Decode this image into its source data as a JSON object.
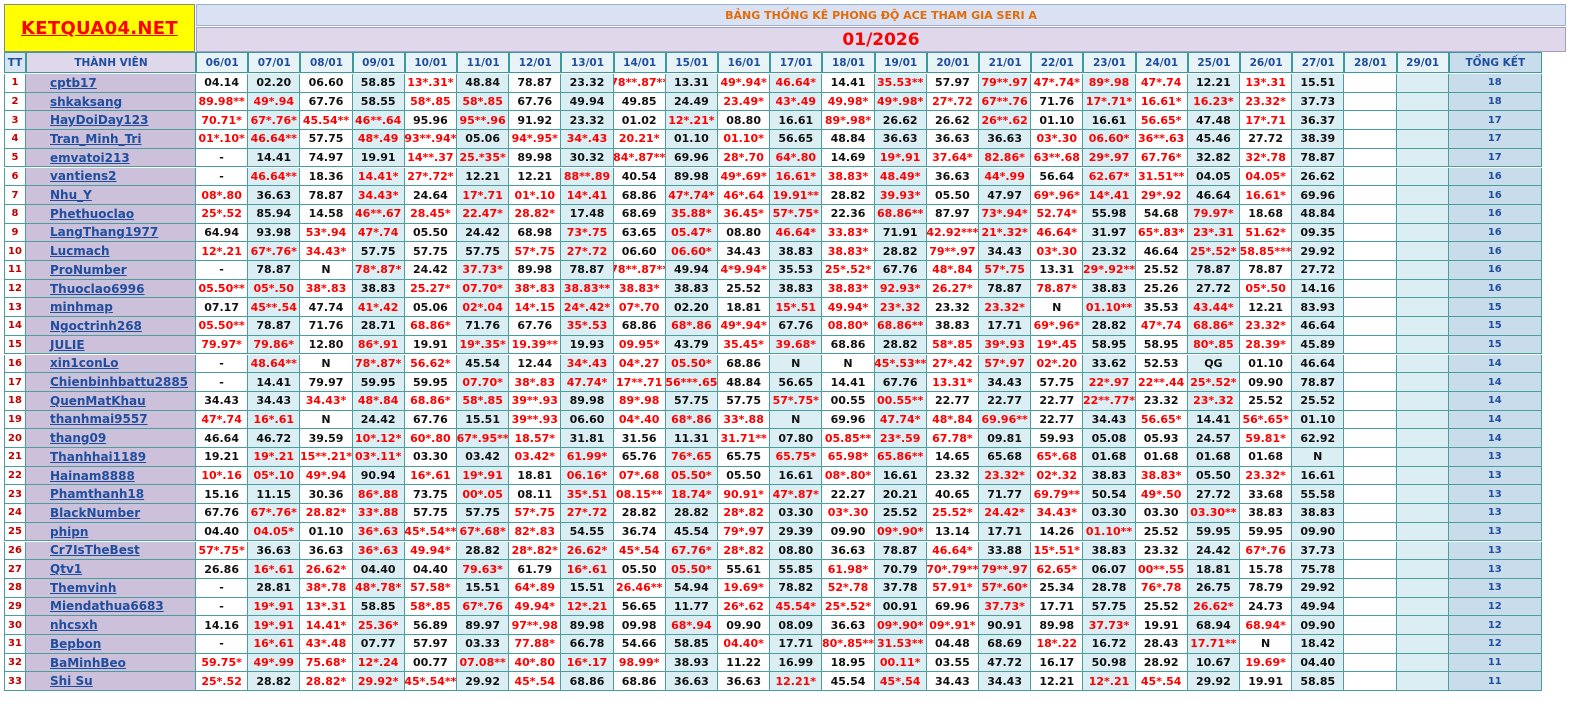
{
  "logo": "KETQUA04.NET",
  "title": "BẢNG THỐNG KÊ PHONG ĐỘ ACE THAM GIA SERI A",
  "month": "01/2026",
  "headers": {
    "tt": "TT",
    "name": "THÀNH VIÊN",
    "total": "TỔNG KẾT"
  },
  "dates": [
    "06/01",
    "07/01",
    "08/01",
    "09/01",
    "10/01",
    "11/01",
    "12/01",
    "13/01",
    "14/01",
    "15/01",
    "16/01",
    "17/01",
    "18/01",
    "19/01",
    "20/01",
    "21/01",
    "22/01",
    "23/01",
    "24/01",
    "25/01",
    "26/01",
    "27/01",
    "28/01",
    "29/01"
  ],
  "rows": [
    {
      "tt": "1",
      "name": "cptb17",
      "total": "18",
      "cells": [
        "04.14",
        "02.20",
        "06.60",
        "58.85",
        "13*.31*",
        "48.84",
        "78.87",
        "23.32",
        "78**.87**",
        "13.31",
        "49*.94*",
        "46.64*",
        "14.41",
        "35.53**",
        "57.97",
        "79**.97",
        "47*.74*",
        "89*.98",
        "47*.74",
        "12.21",
        "13*.31",
        "15.51",
        "",
        ""
      ]
    },
    {
      "tt": "2",
      "name": "shkaksang",
      "total": "18",
      "cells": [
        "89.98**",
        "49*.94",
        "67.76",
        "58.55",
        "58*.85",
        "58*.85",
        "67.76",
        "49.94",
        "49.85",
        "24.49",
        "23.49*",
        "43*.49",
        "49.98*",
        "49*.98*",
        "27*.72",
        "67**.76",
        "71.76",
        "17*.71*",
        "16.61*",
        "16.23*",
        "23.32*",
        "37.73",
        "",
        ""
      ]
    },
    {
      "tt": "3",
      "name": "HayDoiDay123",
      "total": "17",
      "cells": [
        "70.71*",
        "67*.76*",
        "45.54**",
        "46**.64",
        "95.96",
        "95**.96",
        "91.92",
        "23.32",
        "01.02",
        "12*.21*",
        "08.80",
        "16.61",
        "89*.98*",
        "26.62",
        "26.62",
        "26**.62",
        "01.10",
        "16.61",
        "56.65*",
        "47.48",
        "17*.71",
        "36.37",
        "",
        ""
      ]
    },
    {
      "tt": "4",
      "name": "Tran_Minh_Tri",
      "total": "17",
      "cells": [
        "01*.10*",
        "46.64**",
        "57.75",
        "48*.49",
        "93**.94*",
        "05.06",
        "94*.95*",
        "34*.43",
        "20.21*",
        "01.10",
        "01.10*",
        "56.65",
        "48.84",
        "36.63",
        "36.63",
        "36.63",
        "03*.30",
        "06.60*",
        "36**.63",
        "45.46",
        "27.72",
        "38.39",
        "",
        ""
      ]
    },
    {
      "tt": "5",
      "name": "emvatoi213",
      "total": "17",
      "cells": [
        "-",
        "14.41",
        "74.97",
        "19.91",
        "14**.37",
        "25.*35*",
        "89.98",
        "30.32",
        "84*.87**",
        "69.96",
        "28*.70",
        "64*.80",
        "14.69",
        "19*.91",
        "37.64*",
        "82.86*",
        "63**.68",
        "29*.97",
        "67.76*",
        "32.82",
        "32*.78",
        "78.87",
        "",
        ""
      ]
    },
    {
      "tt": "6",
      "name": "vantiens2",
      "total": "16",
      "cells": [
        "-",
        "46.64**",
        "18.36",
        "14.41*",
        "27*.72*",
        "12.21",
        "12.21",
        "88**.89",
        "40.54",
        "89.98",
        "49*.69*",
        "16.61*",
        "38.83*",
        "48.49*",
        "36.63",
        "44*.99",
        "56.64",
        "62.67*",
        "31.51**",
        "04.05",
        "04.05*",
        "26.62",
        "",
        ""
      ]
    },
    {
      "tt": "7",
      "name": "Nhu_Y",
      "total": "16",
      "cells": [
        "08*.80",
        "36.63",
        "78.87",
        "34.43*",
        "24.64",
        "17*.71",
        "01*.10",
        "14*.41",
        "68.86",
        "47*.74*",
        "46*.64",
        "19.91**",
        "28.82",
        "39.93*",
        "05.50",
        "47.97",
        "69*.96*",
        "14*.41",
        "29*.92",
        "46.64",
        "16.61*",
        "69.96",
        "",
        ""
      ]
    },
    {
      "tt": "8",
      "name": "Phethuoclao",
      "total": "16",
      "cells": [
        "25*.52",
        "85.94",
        "14.58",
        "46**.67",
        "28.45*",
        "22.47*",
        "28.82*",
        "17.48",
        "68.69",
        "35.88*",
        "36.45*",
        "57*.75*",
        "22.36",
        "68.86**",
        "87.97",
        "73*.94*",
        "52.74*",
        "55.98",
        "54.68",
        "79.97*",
        "18.68",
        "48.84",
        "",
        ""
      ]
    },
    {
      "tt": "9",
      "name": "LangThang1977",
      "total": "16",
      "cells": [
        "64.94",
        "93.98",
        "53*.94",
        "47*.74",
        "05.50",
        "24.42",
        "68.98",
        "73*.75",
        "63.65",
        "05.47*",
        "08.80",
        "46.64*",
        "33.83*",
        "71.91",
        "42.92***",
        "21*.32*",
        "46.64*",
        "31.97",
        "65*.83*",
        "23*.31",
        "51.62*",
        "09.35",
        "",
        ""
      ]
    },
    {
      "tt": "10",
      "name": "Lucmach",
      "total": "16",
      "cells": [
        "12*.21",
        "67*.76*",
        "34.43*",
        "57.75",
        "57.75",
        "57.75",
        "57*.75",
        "27*.72",
        "06.60",
        "06.60*",
        "34.43",
        "38.83",
        "38.83*",
        "28.82",
        "79**.97",
        "34.43",
        "03*.30",
        "23.32",
        "46.64",
        "25*.52*",
        "58.85***",
        "29.92",
        "",
        ""
      ]
    },
    {
      "tt": "11",
      "name": "ProNumber",
      "total": "16",
      "cells": [
        "-",
        "78.87",
        "N",
        "78*.87*",
        "24.42",
        "37.73*",
        "89.98",
        "78.87",
        "78**.87**",
        "49.94",
        "4*9.94*",
        "35.53",
        "25*.52*",
        "67.76",
        "48*.84",
        "57*.75",
        "13.31",
        "29*.92**",
        "25.52",
        "78.87",
        "78.87",
        "27.72",
        "",
        ""
      ]
    },
    {
      "tt": "12",
      "name": "Thuoclao6996",
      "total": "16",
      "cells": [
        "05.50**",
        "05*.50",
        "38*.83",
        "38.83",
        "25.27*",
        "07.70*",
        "38*.83",
        "38.83**",
        "38.83*",
        "38.83",
        "25.52",
        "38.83",
        "38.83*",
        "92.93*",
        "26.27*",
        "78.87",
        "78.87*",
        "38.83",
        "25.26",
        "27.72",
        "05*.50",
        "14.16",
        "",
        ""
      ]
    },
    {
      "tt": "13",
      "name": "minhmap",
      "total": "15",
      "cells": [
        "07.17",
        "45**.54",
        "47.74",
        "41*.42",
        "05.06",
        "02*.04",
        "14*.15",
        "24*.42*",
        "07*.70",
        "02.20",
        "18.81",
        "15*.51",
        "49.94*",
        "23*.32",
        "23.32",
        "23.32*",
        "N",
        "01.10**",
        "35.53",
        "43.44*",
        "12.21",
        "83.93",
        "",
        ""
      ]
    },
    {
      "tt": "14",
      "name": "Ngoctrinh268",
      "total": "15",
      "cells": [
        "05.50**",
        "78.87",
        "71.76",
        "28.71",
        "68.86*",
        "71.76",
        "67.76",
        "35*.53",
        "68.86",
        "68*.86",
        "49*.94*",
        "67.76",
        "08.80*",
        "68.86**",
        "38.83",
        "17.71",
        "69*.96*",
        "28.82",
        "47*.74",
        "68.86*",
        "23.32*",
        "46.64",
        "",
        ""
      ]
    },
    {
      "tt": "15",
      "name": "JULIE",
      "total": "15",
      "cells": [
        "79.97*",
        "79.86*",
        "12.80",
        "86*.91",
        "19.91",
        "19*.35*",
        "19.39**",
        "19.93",
        "09.95*",
        "43.79",
        "35.45*",
        "39.68*",
        "68.86",
        "28.82",
        "58*.85",
        "39*.93",
        "19*.45",
        "58.95",
        "58.95",
        "80*.85",
        "28.39*",
        "45.89",
        "",
        ""
      ]
    },
    {
      "tt": "16",
      "name": "xin1conLo",
      "total": "14",
      "cells": [
        "-",
        "48.64**",
        "N",
        "78*.87*",
        "56.62*",
        "45.54",
        "12.44",
        "34*.43",
        "04*.27",
        "05.50*",
        "68.86",
        "N",
        "N",
        "45*.53**",
        "27*.42",
        "57*.97",
        "02*.20",
        "33.62",
        "52.53",
        "QG",
        "01.10",
        "46.64",
        "",
        ""
      ]
    },
    {
      "tt": "17",
      "name": "Chienbinhbattu2885",
      "total": "14",
      "cells": [
        "-",
        "14.41",
        "79.97",
        "59.95",
        "59.95",
        "07.70*",
        "38*.83",
        "47.74*",
        "17**.71",
        "56***.65",
        "48.84",
        "56.65",
        "14.41",
        "67.76",
        "13.31*",
        "34.43",
        "57.75",
        "22*.97",
        "22**.44",
        "25*.52*",
        "09.90",
        "78.87",
        "",
        ""
      ]
    },
    {
      "tt": "18",
      "name": "QuenMatKhau",
      "total": "14",
      "cells": [
        "34.43",
        "34.43",
        "34.43*",
        "48*.84",
        "68.86*",
        "58*.85",
        "39**.93",
        "89.98",
        "89*.98",
        "57.75",
        "57.75",
        "57*.75*",
        "00.55",
        "00.55**",
        "22.77",
        "22.77",
        "22.77",
        "22**.77*",
        "23.32",
        "23*.32",
        "25.52",
        "25.52",
        "",
        ""
      ]
    },
    {
      "tt": "19",
      "name": "thanhmai9557",
      "total": "14",
      "cells": [
        "47*.74",
        "16*.61",
        "N",
        "24.42",
        "67.76",
        "15.51",
        "39**.93",
        "06.60",
        "04*.40",
        "68*.86",
        "33*.88",
        "N",
        "69.96",
        "47.74*",
        "48*.84",
        "69.96**",
        "22.77",
        "34.43",
        "56.65*",
        "14.41",
        "56*.65*",
        "01.10",
        "",
        ""
      ]
    },
    {
      "tt": "20",
      "name": "thang09",
      "total": "14",
      "cells": [
        "46.64",
        "46.72",
        "39.59",
        "10*.12*",
        "60*.80",
        "67*.95**",
        "18.57*",
        "31.81",
        "31.56",
        "11.31",
        "31.71**",
        "07.80",
        "05.85**",
        "23*.59",
        "67.78*",
        "09.81",
        "59.93",
        "05.08",
        "05.93",
        "24.57",
        "59.81*",
        "62.92",
        "",
        ""
      ]
    },
    {
      "tt": "21",
      "name": "Thanhhai1189",
      "total": "13",
      "cells": [
        "19.21",
        "19*.21",
        "15**.21*",
        "03*.11*",
        "03.30",
        "03.42",
        "03.42*",
        "61.99*",
        "65.76",
        "76*.65",
        "65.75",
        "65.75*",
        "65.98*",
        "65.86**",
        "14.65",
        "65.68",
        "65*.68",
        "01.68",
        "01.68",
        "01.68",
        "01.68",
        "N",
        "",
        ""
      ]
    },
    {
      "tt": "22",
      "name": "Hainam8888",
      "total": "13",
      "cells": [
        "10*.16",
        "05*.10",
        "49*.94",
        "90.94",
        "16*.61",
        "19*.91",
        "18.81",
        "06.16*",
        "07*.68",
        "05.50*",
        "05.50",
        "16.61",
        "08*.80*",
        "16.61",
        "23.32",
        "23.32*",
        "02*.32",
        "38.83",
        "38.83*",
        "05.50",
        "23.32*",
        "16.61",
        "",
        ""
      ]
    },
    {
      "tt": "23",
      "name": "Phamthanh18",
      "total": "13",
      "cells": [
        "15.16",
        "11.15",
        "30.36",
        "86*.88",
        "73.75",
        "00*.05",
        "08.11",
        "35*.51",
        "08.15**",
        "18.74*",
        "90.91*",
        "47*.87*",
        "22.27",
        "20.21",
        "40.65",
        "71.77",
        "69.79**",
        "50.54",
        "49*.50",
        "27.72",
        "33.68",
        "55.58",
        "",
        ""
      ]
    },
    {
      "tt": "24",
      "name": "BlackNumber",
      "total": "13",
      "cells": [
        "67.76",
        "67*.76*",
        "28.82*",
        "33*.88",
        "57.75",
        "57.75",
        "57*.75",
        "27*.72",
        "28.82",
        "28.82",
        "28*.82",
        "03.30",
        "03*.30",
        "25.52",
        "25.52*",
        "24.42*",
        "34.43*",
        "03.30",
        "03.30",
        "03.30**",
        "38.83",
        "38.83",
        "",
        ""
      ]
    },
    {
      "tt": "25",
      "name": "phipn",
      "total": "13",
      "cells": [
        "04.40",
        "04.05*",
        "01.10",
        "36*.63",
        "45*.54**",
        "67*.68*",
        "82*.83",
        "54.55",
        "36.74",
        "45.54",
        "79*.97",
        "29.39",
        "09.90",
        "09*.90*",
        "13.14",
        "17.71",
        "14.26",
        "01.10**",
        "25.52",
        "59.95",
        "59.95",
        "09.90",
        "",
        ""
      ]
    },
    {
      "tt": "26",
      "name": "Cr7IsTheBest",
      "total": "13",
      "cells": [
        "57*.75*",
        "36.63",
        "36.63",
        "36*.63",
        "49.94*",
        "28.82",
        "28*.82*",
        "26.62*",
        "45*.54",
        "67.76*",
        "28*.82",
        "08.80",
        "36.63",
        "78.87",
        "46.64*",
        "33.88",
        "15*.51*",
        "38.83",
        "23.32",
        "24.42",
        "67*.76",
        "37.73",
        "",
        ""
      ]
    },
    {
      "tt": "27",
      "name": "Qtv1",
      "total": "13",
      "cells": [
        "26.86",
        "16*.61",
        "26.62*",
        "04.40",
        "04.40",
        "79.63*",
        "61.79",
        "16*.61",
        "05.50",
        "05.50*",
        "55.61",
        "55.85",
        "61.98*",
        "70.79",
        "70*.79**",
        "79**.97",
        "62.65*",
        "06.07",
        "00**.55",
        "18.81",
        "15.78",
        "75.78",
        "",
        ""
      ]
    },
    {
      "tt": "28",
      "name": "Themvinh",
      "total": "13",
      "cells": [
        "-",
        "28.81",
        "38*.78",
        "48*.78*",
        "57.58*",
        "15.51",
        "64*.89",
        "15.51",
        "26.46**",
        "54.94",
        "19.69*",
        "78.82",
        "52*.78",
        "37.78",
        "57.91*",
        "57*.60*",
        "25.34",
        "28.78",
        "76*.78",
        "26.75",
        "78.79",
        "29.92",
        "",
        ""
      ]
    },
    {
      "tt": "29",
      "name": "Miendathua6683",
      "total": "12",
      "cells": [
        "-",
        "19*.91",
        "13*.31",
        "58.85",
        "58*.85",
        "67*.76",
        "49.94*",
        "12*.21",
        "56.65",
        "11.77",
        "26*.62",
        "45.54*",
        "25*.52*",
        "00.91",
        "69.96",
        "37.73*",
        "17.71",
        "57.75",
        "25.52",
        "26.62*",
        "24.73",
        "49.94",
        "",
        ""
      ]
    },
    {
      "tt": "30",
      "name": "nhcsxh",
      "total": "12",
      "cells": [
        "14.16",
        "19*.91",
        "14.41*",
        "25.36*",
        "56.89",
        "89.97",
        "97**.98",
        "89.98",
        "09.98",
        "68*.94",
        "09.90",
        "08.09",
        "36.63",
        "09*.90*",
        "09*.91*",
        "90.91",
        "89.98",
        "37.73*",
        "19.91",
        "68.94",
        "68.94*",
        "09.90",
        "",
        ""
      ]
    },
    {
      "tt": "31",
      "name": "Bepbon",
      "total": "12",
      "cells": [
        "-",
        "16*.61",
        "43*.48",
        "07.77",
        "57.97",
        "03.33",
        "77.88*",
        "66.78",
        "54.66",
        "58.85",
        "04.40*",
        "17.71",
        "80*.85**",
        "31.53**",
        "04.48",
        "68.69",
        "18*.22",
        "16.72",
        "28.43",
        "17.71**",
        "N",
        "18.42",
        "",
        ""
      ]
    },
    {
      "tt": "32",
      "name": "BaMinhBeo",
      "total": "11",
      "cells": [
        "59.75*",
        "49*.99",
        "75.68*",
        "12*.24",
        "00.77",
        "07.08**",
        "40*.80",
        "16*.17",
        "98.99*",
        "38.93",
        "11.22",
        "16.99",
        "18.95",
        "00.11*",
        "03.55",
        "47.72",
        "16.17",
        "50.98",
        "28.92",
        "10.67",
        "19.69*",
        "04.40",
        "",
        ""
      ]
    },
    {
      "tt": "33",
      "name": "Shi Su",
      "total": "11",
      "cells": [
        "25*.52",
        "28.82",
        "28.82*",
        "29.92*",
        "45*.54**",
        "29.92",
        "45*.54",
        "68.86",
        "68.86",
        "36.63",
        "36.63",
        "12.21*",
        "45.54",
        "45*.54",
        "34.43",
        "34.43",
        "12.21",
        "12*.21",
        "45*.54",
        "29.92",
        "19.91",
        "58.85",
        "",
        ""
      ]
    }
  ]
}
